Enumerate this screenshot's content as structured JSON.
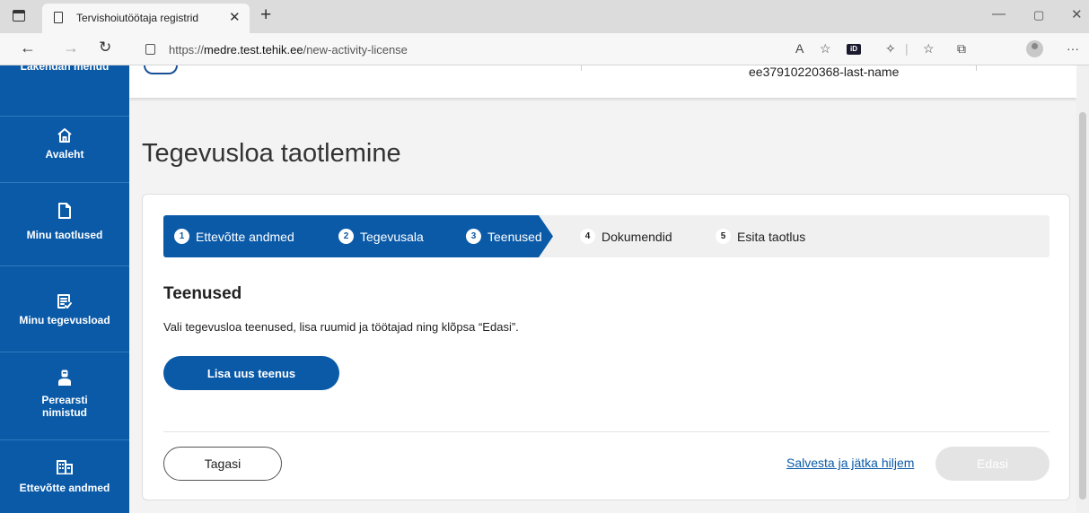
{
  "browser": {
    "tab_title": "Tervishoiutöötaja registrid",
    "url_prefix": "https://",
    "url_domain": "medre.test.tehik.ee",
    "url_path": "/new-activity-license"
  },
  "sidebar": {
    "partial_label": "Lakendan menuu",
    "items": [
      {
        "label": "Avaleht",
        "icon": "home-icon"
      },
      {
        "label": "Minu taotlused",
        "icon": "document-icon"
      },
      {
        "label": "Minu tegevusload",
        "icon": "license-list-icon"
      },
      {
        "label": "Perearsti nimistud",
        "icon": "doctor-icon"
      },
      {
        "label": "Ettevõtte andmed",
        "icon": "building-icon"
      }
    ]
  },
  "header": {
    "user_name": "ee37910220368-last-name"
  },
  "main": {
    "page_title": "Tegevusloa taotlemine",
    "steps": [
      {
        "num": "1",
        "label": "Ettevõtte andmed",
        "state": "done"
      },
      {
        "num": "2",
        "label": "Tegevusala",
        "state": "done"
      },
      {
        "num": "3",
        "label": "Teenused",
        "state": "active"
      },
      {
        "num": "4",
        "label": "Dokumendid",
        "state": "todo"
      },
      {
        "num": "5",
        "label": "Esita taotlus",
        "state": "todo"
      }
    ],
    "section_title": "Teenused",
    "section_description": "Vali tegevusloa teenused, lisa ruumid ja töötajad ning klõpsa “Edasi”.",
    "add_service_label": "Lisa uus teenus",
    "back_label": "Tagasi",
    "save_link_label": "Salvesta ja jätka hiljem",
    "next_label": "Edasi"
  },
  "colors": {
    "primary": "#0a5aa8",
    "sidebar_bg": "#0a5aa8",
    "disabled_bg": "#e4e4e4"
  }
}
